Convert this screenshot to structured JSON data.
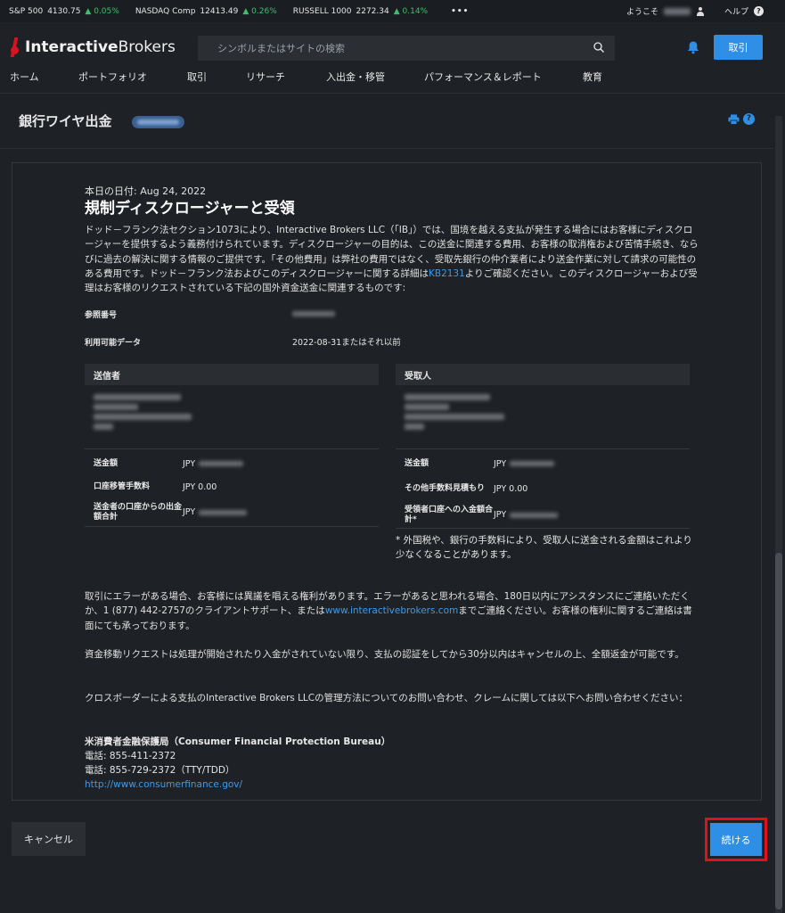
{
  "tickers": [
    {
      "name": "S&P 500",
      "value": "4130.75",
      "change": "0.05%"
    },
    {
      "name": "NASDAQ Comp",
      "value": "12413.49",
      "change": "0.26%"
    },
    {
      "name": "RUSSELL 1000",
      "value": "2272.34",
      "change": "0.14%"
    }
  ],
  "topbar": {
    "more": "•••",
    "welcome": "ようこそ",
    "help": "ヘルプ",
    "help_icon": "?"
  },
  "brand": {
    "part1": "Interactive",
    "part2": "Brokers"
  },
  "search": {
    "placeholder": "シンボルまたはサイトの検索"
  },
  "header": {
    "trade_label": "取引"
  },
  "nav": [
    "ホーム",
    "ポートフォリオ",
    "取引",
    "リサーチ",
    "入出金・移管",
    "パフォーマンス＆レポート",
    "教育"
  ],
  "page": {
    "title": "銀行ワイヤ出金",
    "help_icon": "?"
  },
  "disclosure": {
    "date": "本日の日付: Aug 24, 2022",
    "heading": "規制ディスクロージャーと受領",
    "intro_a": "ドッド－フランク法セクション1073により、Interactive Brokers LLC（「IB」）では、国境を越える支払が発生する場合にはお客様にディスクロージャーを提供するよう義務付けられています。ディスクロージャーの目的は、この送金に関連する費用、お客様の取消権および苦情手続き、ならびに過去の解決に関する情報のご提供です。「その他費用」は弊社の費用ではなく、受取先銀行の仲介業者により送金作業に対して請求の可能性のある費用です。ドッド－フランク法およびこのディスクロージャーに関する詳細は",
    "intro_link": "KB2131",
    "intro_b": "よりご確認ください。このディスクロージャーおよび受理はお客様のリクエストされている下記の国外資金送金に関連するものです:",
    "ref_label": "参照番号",
    "available_label": "利用可能データ",
    "available_value": "2022-08-31またはそれ以前"
  },
  "sender": {
    "title": "送信者",
    "rows": [
      {
        "label": "送金額",
        "currency": "JPY",
        "value": ""
      },
      {
        "label": "口座移管手数料",
        "currency": "JPY",
        "value": "0.00"
      },
      {
        "label": "送金者の口座からの出金額合計",
        "currency": "JPY",
        "value": ""
      }
    ]
  },
  "receiver": {
    "title": "受取人",
    "rows": [
      {
        "label": "送金額",
        "currency": "JPY",
        "value": ""
      },
      {
        "label": "その他手数料見積もり",
        "currency": "JPY",
        "value": "0.00"
      },
      {
        "label": "受領者口座への入金額合計*",
        "currency": "JPY",
        "value": ""
      }
    ],
    "note": "* 外国税や、銀行の手数料により、受取人に送金される金額はこれより少なくなることがあります。"
  },
  "footer_text": {
    "error_a": "取引にエラーがある場合、お客様には異議を唱える権利があります。エラーがあると思われる場合、180日以内にアシスタンスにご連絡いただくか、1 (877) 442-2757のクライアントサポート、または",
    "error_link": "www.interactivebrokers.com",
    "error_b": "までご連絡ください。お客様の権利に関するご連絡は書面にても承っております。",
    "refund": "資金移動リクエストは処理が開始されたり入金がされていない限り、支払の認証をしてから30分以内はキャンセルの上、全額返金が可能です。",
    "crossborder": "クロスボーダーによる支払のInteractive Brokers LLCの管理方法についてのお問い合わせ、クレームに関しては以下へお問い合わせください："
  },
  "cfpb": {
    "name": "米消費者金融保護局（Consumer Financial Protection Bureau）",
    "phone1": "電話: 855-411-2372",
    "phone2": "電話: 855-729-2372（TTY/TDD）",
    "url": "http://www.consumerfinance.gov/"
  },
  "actions": {
    "cancel": "キャンセル",
    "continue": "続ける"
  },
  "colors": {
    "accent": "#2f8fe6",
    "positive": "#3cc06a",
    "highlight": "#e0101c",
    "brand_red": "#d81222"
  }
}
